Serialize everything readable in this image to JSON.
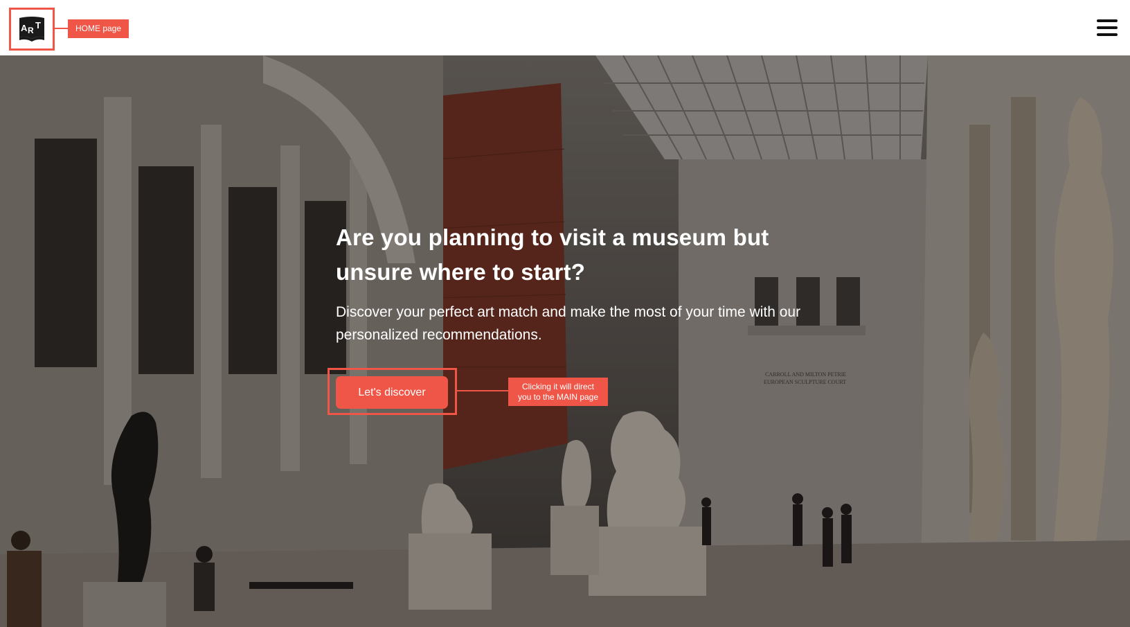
{
  "header": {
    "logo_letters": "ART",
    "home_annotation": "HOME page",
    "menu_icon": "hamburger-menu-icon"
  },
  "hero": {
    "title": "Are you planning to visit a museum but unsure where to start?",
    "subtitle": "Discover your perfect art match and make the most of your time with our personalized recommendations.",
    "cta_label": "Let's discover",
    "cta_annotation": "Clicking it will direct\nyou to the MAIN page",
    "background_sign": "CARROLL AND MILTON PETRIE\nEUROPEAN SCULPTURE COURT"
  },
  "colors": {
    "accent": "#ef5648",
    "header_bg": "#ffffff",
    "text_on_hero": "#ffffff",
    "logo_bg": "#1a1a1a"
  }
}
